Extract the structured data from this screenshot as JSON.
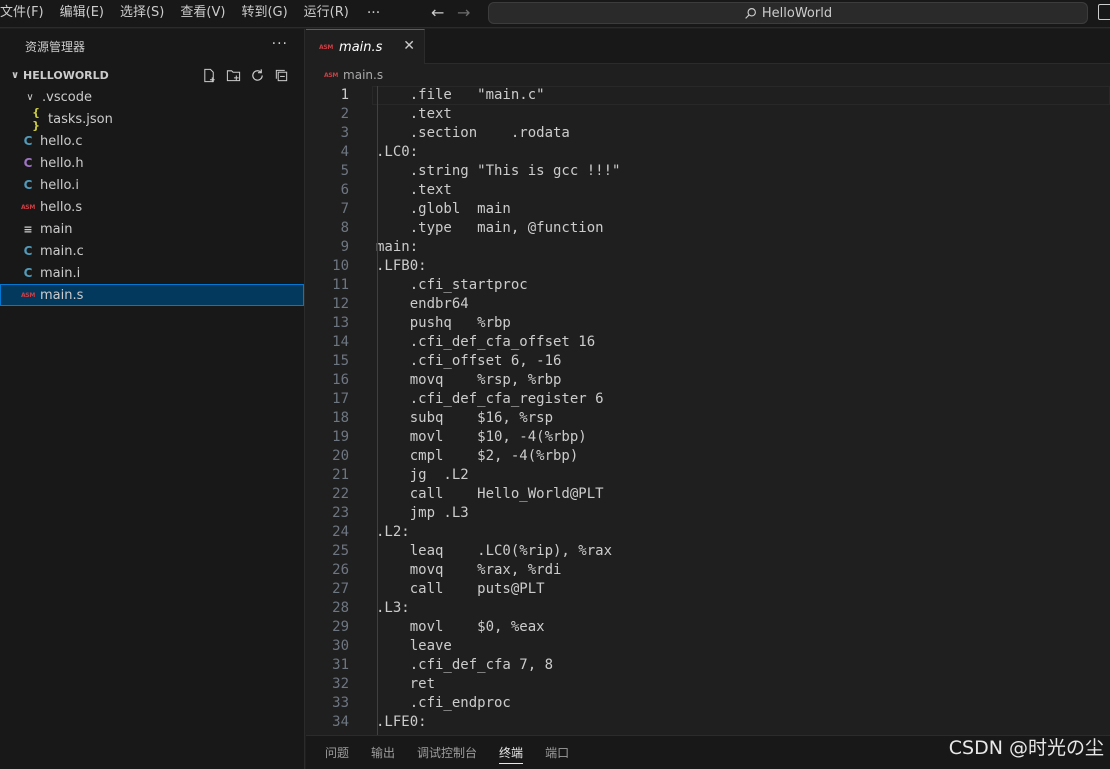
{
  "menu": [
    "文件(F)",
    "编辑(E)",
    "选择(S)",
    "查看(V)",
    "转到(G)",
    "运行(R)"
  ],
  "menu_more": "···",
  "command_center": "HelloWorld",
  "sidebar": {
    "title": "资源管理器",
    "more": "···",
    "folder": "HELLOWORLD",
    "items": [
      {
        "label": ".vscode",
        "icon": "chevron-down-icon",
        "glyph": "∨",
        "type": "folder"
      },
      {
        "label": "tasks.json",
        "icon": "json-file-icon",
        "glyph": "{ }",
        "type": "json"
      },
      {
        "label": "hello.c",
        "icon": "c-file-icon",
        "glyph": "C",
        "type": "c"
      },
      {
        "label": "hello.h",
        "icon": "h-file-icon",
        "glyph": "C",
        "type": "h"
      },
      {
        "label": "hello.i",
        "icon": "c-file-icon",
        "glyph": "C",
        "type": "c"
      },
      {
        "label": "hello.s",
        "icon": "asm-file-icon",
        "glyph": "ASM",
        "type": "asm"
      },
      {
        "label": "main",
        "icon": "binary-file-icon",
        "glyph": "≡",
        "type": "file"
      },
      {
        "label": "main.c",
        "icon": "c-file-icon",
        "glyph": "C",
        "type": "c"
      },
      {
        "label": "main.i",
        "icon": "c-file-icon",
        "glyph": "C",
        "type": "c"
      },
      {
        "label": "main.s",
        "icon": "asm-file-icon",
        "glyph": "ASM",
        "type": "asm",
        "selected": true
      }
    ]
  },
  "editor": {
    "tab": {
      "label": "main.s",
      "icon_glyph": "ASM",
      "close": "✕"
    },
    "breadcrumb": {
      "label": "main.s",
      "icon_glyph": "ASM"
    },
    "current_line": 1,
    "lines": [
      "    .file   \"main.c\"",
      "    .text",
      "    .section    .rodata",
      ".LC0:",
      "    .string \"This is gcc !!!\"",
      "    .text",
      "    .globl  main",
      "    .type   main, @function",
      "main:",
      ".LFB0:",
      "    .cfi_startproc",
      "    endbr64",
      "    pushq   %rbp",
      "    .cfi_def_cfa_offset 16",
      "    .cfi_offset 6, -16",
      "    movq    %rsp, %rbp",
      "    .cfi_def_cfa_register 6",
      "    subq    $16, %rsp",
      "    movl    $10, -4(%rbp)",
      "    cmpl    $2, -4(%rbp)",
      "    jg  .L2",
      "    call    Hello_World@PLT",
      "    jmp .L3",
      ".L2:",
      "    leaq    .LC0(%rip), %rax",
      "    movq    %rax, %rdi",
      "    call    puts@PLT",
      ".L3:",
      "    movl    $0, %eax",
      "    leave",
      "    .cfi_def_cfa 7, 8",
      "    ret",
      "    .cfi_endproc",
      ".LFE0:"
    ]
  },
  "panel": {
    "tabs": [
      "问题",
      "输出",
      "调试控制台",
      "终端",
      "端口"
    ],
    "active": "终端"
  },
  "watermark": "CSDN @时光の尘"
}
